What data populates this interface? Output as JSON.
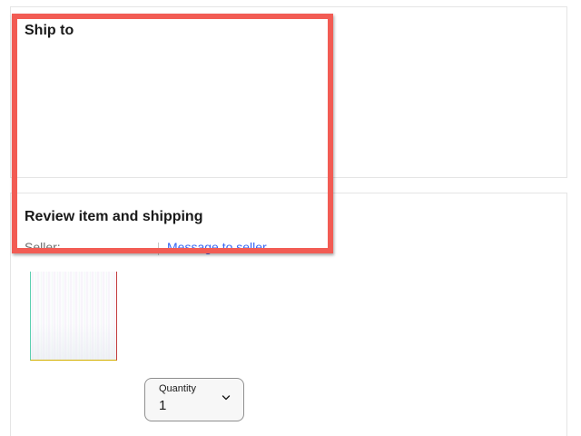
{
  "ship_to": {
    "heading": "Ship to"
  },
  "review": {
    "heading": "Review item and shipping",
    "seller_label": "Seller:",
    "message_seller_link": "Message to seller"
  },
  "item": {
    "thumbnail_icon": "product-image",
    "quantity": {
      "label": "Quantity",
      "value": "1",
      "chevron_icon": "chevron-down-icon"
    }
  },
  "overlay": {
    "highlight_color": "#f25c54"
  }
}
